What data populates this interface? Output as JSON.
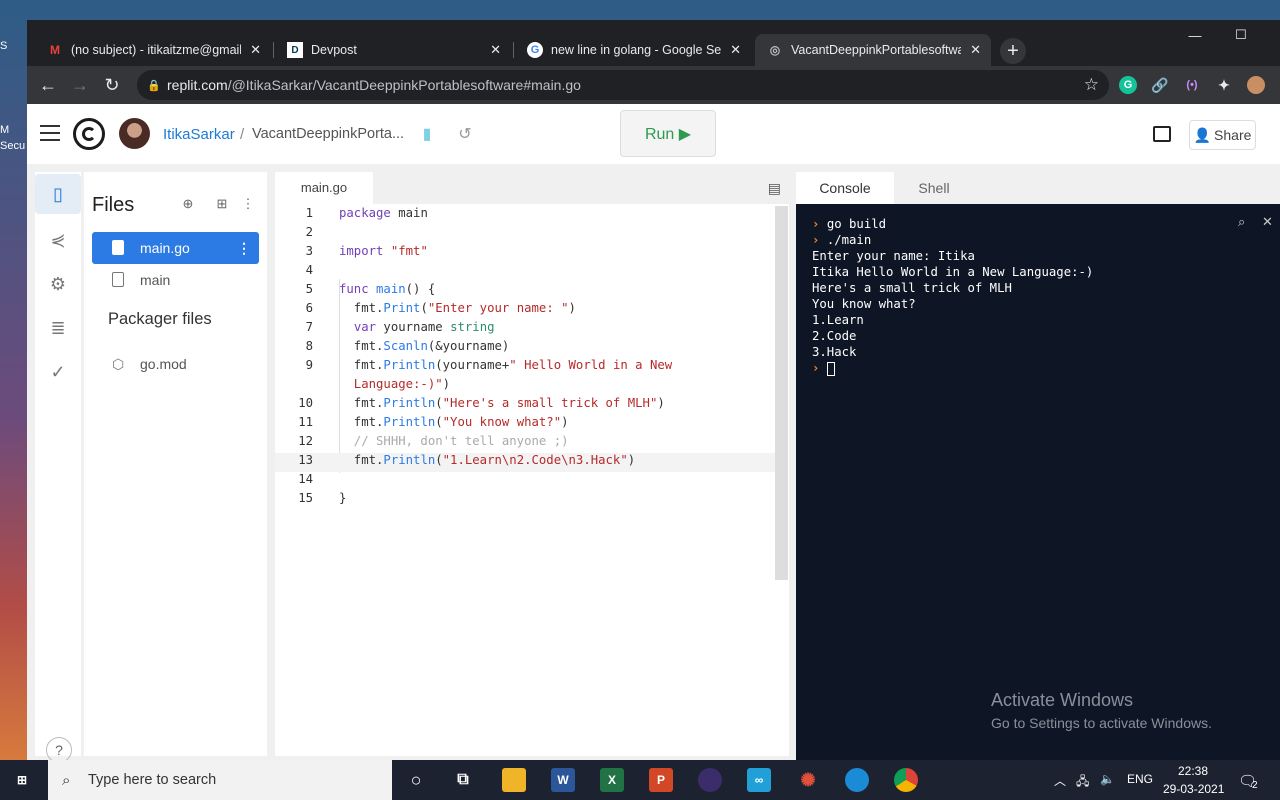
{
  "browser": {
    "tabs": [
      {
        "icon": "gmail-icon",
        "title": "(no subject) - itikaitzme@gmail.c"
      },
      {
        "icon": "devpost-icon",
        "title": "Devpost"
      },
      {
        "icon": "google-icon",
        "title": "new line in golang - Google Sear"
      },
      {
        "icon": "replit-icon",
        "title": "VacantDeeppinkPortablesoftware"
      }
    ],
    "url_host": "replit.com",
    "url_path": "/@ItikaSarkar/VacantDeeppinkPortablesoftware#main.go"
  },
  "header": {
    "username": "ItikaSarkar",
    "separator": "/",
    "repl_name": "VacantDeeppinkPorta...",
    "run_label": "Run ▶",
    "share_label": "Share"
  },
  "files": {
    "title": "Files",
    "items": [
      {
        "name": "main.go"
      },
      {
        "name": "main"
      }
    ],
    "packager_title": "Packager files",
    "packager_items": [
      {
        "name": "go.mod"
      }
    ]
  },
  "editor": {
    "tab": "main.go",
    "lines": [
      "1",
      "2",
      "3",
      "4",
      "5",
      "6",
      "7",
      "8",
      "9",
      "",
      "10",
      "11",
      "12",
      "13",
      "14",
      "15"
    ]
  },
  "panel": {
    "tabs": [
      "Console",
      "Shell"
    ],
    "output": [
      "go build",
      "./main",
      "Enter your name: Itika",
      "Itika Hello World in a New Language:-)",
      "Here's a small trick of MLH",
      "You know what?",
      "1.Learn",
      "2.Code",
      "3.Hack"
    ],
    "watermark_title": "Activate Windows",
    "watermark_sub": "Go to Settings to activate Windows."
  },
  "taskbar": {
    "search_placeholder": "Type here to search",
    "lang": "ENG",
    "time": "22:38",
    "date": "29-03-2021",
    "notifications": "2"
  },
  "desktop": {
    "icon_labels": [
      "S",
      "M",
      "Secu"
    ]
  }
}
